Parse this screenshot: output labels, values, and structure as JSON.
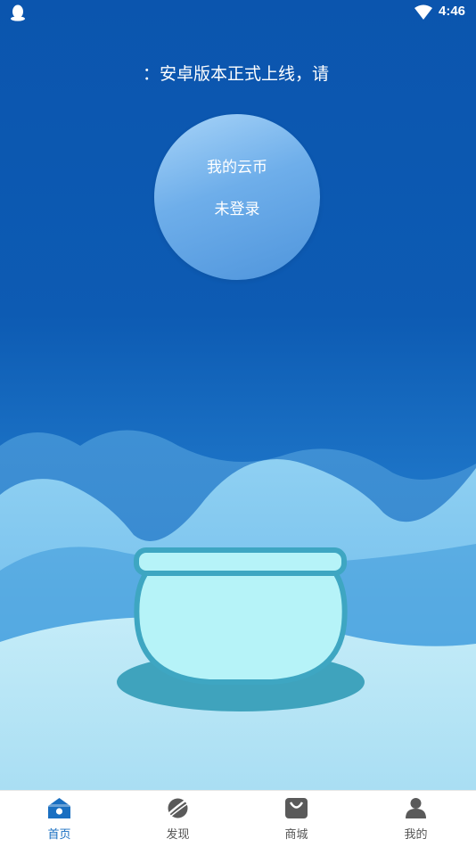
{
  "status_bar": {
    "time": "4:46",
    "left_icon": "qq-penguin-icon",
    "wifi_icon": "wifi-icon"
  },
  "marquee": {
    "text": "：安卓版本正式上线，请"
  },
  "coin": {
    "title": "我的云币",
    "value": "未登录"
  },
  "scene": {
    "illustration": "fish-bowl-on-hills"
  },
  "tabs": [
    {
      "label": "首页",
      "icon": "home-icon",
      "active": true
    },
    {
      "label": "发现",
      "icon": "planet-icon",
      "active": false
    },
    {
      "label": "商城",
      "icon": "shopping-bag-icon",
      "active": false
    },
    {
      "label": "我的",
      "icon": "user-icon",
      "active": false
    }
  ],
  "colors": {
    "accent": "#1a6fc1",
    "background_top": "#0b55ae",
    "bowl": "#b6f3f8",
    "bowl_border": "#3ea6c2"
  }
}
